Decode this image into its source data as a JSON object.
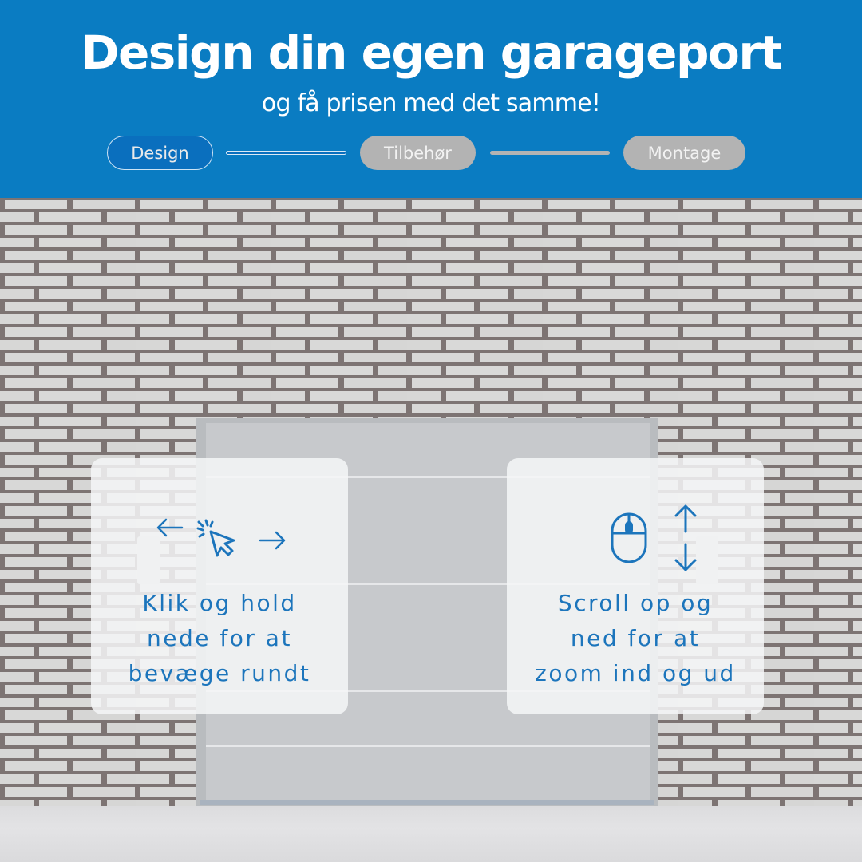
{
  "header": {
    "title": "Design din egen garageport",
    "subtitle": "og få prisen med det samme!",
    "background_color": "#0a7cc2"
  },
  "steps": [
    {
      "label": "Design",
      "state": "active"
    },
    {
      "label": "Tilbehør",
      "state": "inactive"
    },
    {
      "label": "Montage",
      "state": "inactive"
    }
  ],
  "hints": {
    "drag": {
      "icons": [
        "arrow-left-icon",
        "cursor-click-icon",
        "arrow-right-icon"
      ],
      "lines": [
        "Klik og hold",
        "nede for at",
        "bevæge rundt"
      ]
    },
    "zoom": {
      "icons": [
        "mouse-icon",
        "arrow-up-down-icon"
      ],
      "lines": [
        "Scroll op og",
        "ned for at",
        "zoom ind og ud"
      ]
    },
    "accent_color": "#1c75bc"
  }
}
